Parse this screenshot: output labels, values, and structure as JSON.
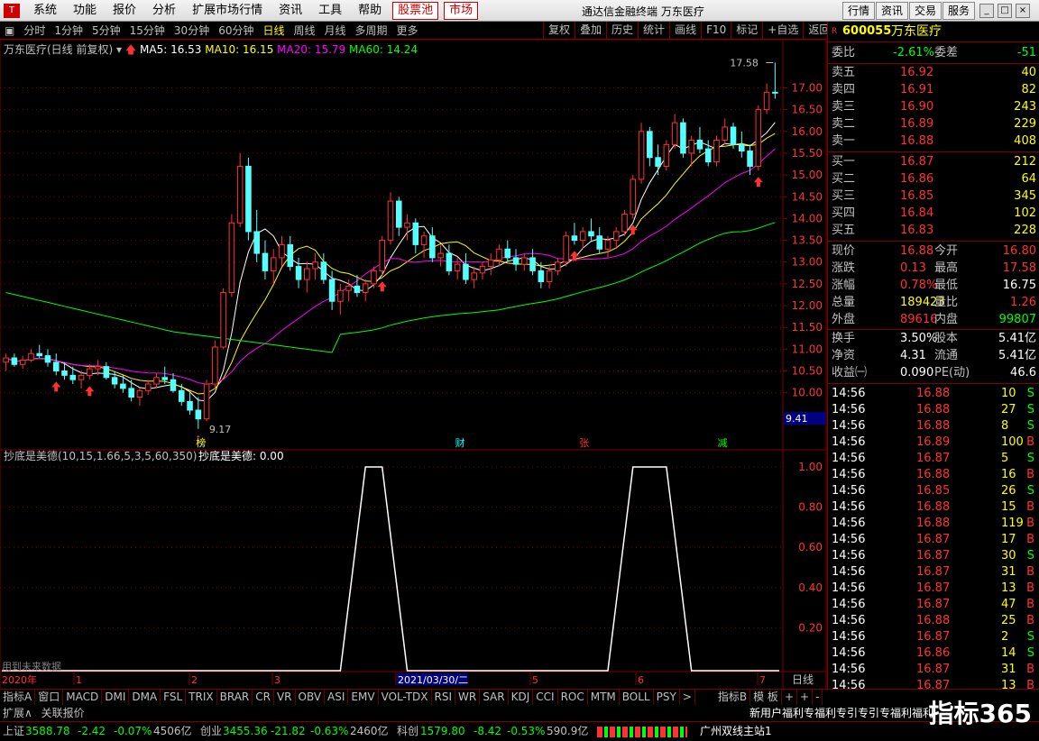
{
  "menu": {
    "logo": "T",
    "items": [
      "系统",
      "功能",
      "报价",
      "分析",
      "扩展市场行情",
      "资讯",
      "工具",
      "帮助"
    ],
    "hot": [
      "股票池",
      "市场"
    ],
    "title": "通达信金融终端  万东医疗",
    "right": [
      "行情",
      "资讯",
      "交易",
      "服务"
    ]
  },
  "period": {
    "items": [
      "分时",
      "1分钟",
      "5分钟",
      "15分钟",
      "30分钟",
      "60分钟",
      "日线",
      "周线",
      "月线",
      "多周期",
      "更多"
    ],
    "active_index": 6,
    "tools": [
      "复权",
      "叠加",
      "历史",
      "统计",
      "画线",
      "F10",
      "标记",
      "+自选",
      "返回"
    ]
  },
  "chart_info": {
    "name": "万东医疗(日线 前复权)",
    "ma5": "MA5: 16.53",
    "ma10": "MA10: 16.15",
    "ma20": "MA20: 15.79",
    "ma60": "MA60: 14.24"
  },
  "colors": {
    "up": "#ff3232",
    "down": "#54ffff",
    "ma5": "#ffffff",
    "ma10": "#ffff00",
    "ma20": "#ff00ff",
    "ma60": "#00ff00",
    "border": "#800000"
  },
  "chart_data": {
    "type": "candlestick",
    "price_axis": [
      "17.00",
      "16.50",
      "16.00",
      "15.50",
      "15.00",
      "14.50",
      "14.00",
      "13.50",
      "13.00",
      "12.50",
      "12.00",
      "11.50",
      "11.00",
      "10.50",
      "10.00"
    ],
    "ylim": [
      9.0,
      17.9
    ],
    "high_label": "17.58",
    "low_label": "9.17",
    "crosshair_value": "9.41",
    "date_axis": [
      "2020年",
      "1",
      "2",
      "3",
      "2021/03/30/二",
      "5",
      "6",
      "7"
    ],
    "period_label": "日线",
    "events": [
      "榜",
      "财",
      "张",
      "减"
    ],
    "candles": [
      [
        10.7,
        10.9,
        10.5,
        10.8
      ],
      [
        10.8,
        10.9,
        10.6,
        10.65
      ],
      [
        10.65,
        10.85,
        10.55,
        10.75
      ],
      [
        10.75,
        11.0,
        10.7,
        10.9
      ],
      [
        10.9,
        11.1,
        10.8,
        10.85
      ],
      [
        10.85,
        11.0,
        10.6,
        10.7
      ],
      [
        10.7,
        10.9,
        10.4,
        10.5
      ],
      [
        10.5,
        10.7,
        10.3,
        10.4
      ],
      [
        10.4,
        10.6,
        10.2,
        10.3
      ],
      [
        10.3,
        10.5,
        10.1,
        10.4
      ],
      [
        10.4,
        10.65,
        10.3,
        10.55
      ],
      [
        10.55,
        10.75,
        10.4,
        10.6
      ],
      [
        10.6,
        10.7,
        10.3,
        10.35
      ],
      [
        10.35,
        10.5,
        10.1,
        10.2
      ],
      [
        10.2,
        10.4,
        10.0,
        10.1
      ],
      [
        10.1,
        10.3,
        9.8,
        9.9
      ],
      [
        9.9,
        10.1,
        9.7,
        10.05
      ],
      [
        10.05,
        10.3,
        9.95,
        10.2
      ],
      [
        10.2,
        10.45,
        10.1,
        10.35
      ],
      [
        10.35,
        10.6,
        10.2,
        10.3
      ],
      [
        10.3,
        10.45,
        10.0,
        10.05
      ],
      [
        10.05,
        10.2,
        9.7,
        9.8
      ],
      [
        9.8,
        10.0,
        9.5,
        9.6
      ],
      [
        9.6,
        9.9,
        9.17,
        9.4
      ],
      [
        9.4,
        10.3,
        9.35,
        10.2
      ],
      [
        10.2,
        11.2,
        10.1,
        11.05
      ],
      [
        11.05,
        12.4,
        11.0,
        12.3
      ],
      [
        12.3,
        14.1,
        12.2,
        13.9
      ],
      [
        13.9,
        15.5,
        13.8,
        15.2
      ],
      [
        15.2,
        15.4,
        13.5,
        13.7
      ],
      [
        13.7,
        14.2,
        13.0,
        13.2
      ],
      [
        13.2,
        13.5,
        12.6,
        12.8
      ],
      [
        12.8,
        13.3,
        12.5,
        13.1
      ],
      [
        13.1,
        13.6,
        12.9,
        13.4
      ],
      [
        13.4,
        13.6,
        12.8,
        12.9
      ],
      [
        12.9,
        13.1,
        12.4,
        12.6
      ],
      [
        12.6,
        13.0,
        12.3,
        12.85
      ],
      [
        12.85,
        13.2,
        12.6,
        13.0
      ],
      [
        13.0,
        13.2,
        12.5,
        12.6
      ],
      [
        12.6,
        12.8,
        11.9,
        12.1
      ],
      [
        12.1,
        12.5,
        11.8,
        12.35
      ],
      [
        12.35,
        12.6,
        12.1,
        12.45
      ],
      [
        12.45,
        12.7,
        12.2,
        12.3
      ],
      [
        12.3,
        12.6,
        12.1,
        12.5
      ],
      [
        12.5,
        12.9,
        12.4,
        12.8
      ],
      [
        12.8,
        13.6,
        12.7,
        13.5
      ],
      [
        13.5,
        14.6,
        13.4,
        14.4
      ],
      [
        14.4,
        14.5,
        13.6,
        13.8
      ],
      [
        13.8,
        14.1,
        13.5,
        13.9
      ],
      [
        13.9,
        14.0,
        13.2,
        13.4
      ],
      [
        13.4,
        13.7,
        13.1,
        13.6
      ],
      [
        13.6,
        13.8,
        13.0,
        13.1
      ],
      [
        13.1,
        13.4,
        12.9,
        13.2
      ],
      [
        13.2,
        13.4,
        12.7,
        12.8
      ],
      [
        12.8,
        13.1,
        12.6,
        12.95
      ],
      [
        12.95,
        13.2,
        12.5,
        12.6
      ],
      [
        12.6,
        12.9,
        12.4,
        12.75
      ],
      [
        12.75,
        13.0,
        12.6,
        12.9
      ],
      [
        12.9,
        13.2,
        12.7,
        13.05
      ],
      [
        13.05,
        13.4,
        12.9,
        13.3
      ],
      [
        13.3,
        13.5,
        13.0,
        13.1
      ],
      [
        13.1,
        13.3,
        12.8,
        12.95
      ],
      [
        12.95,
        13.2,
        12.8,
        13.1
      ],
      [
        13.1,
        13.3,
        12.7,
        12.8
      ],
      [
        12.8,
        13.0,
        12.4,
        12.55
      ],
      [
        12.55,
        12.9,
        12.4,
        12.8
      ],
      [
        12.8,
        13.1,
        12.7,
        13.0
      ],
      [
        13.0,
        13.7,
        12.9,
        13.6
      ],
      [
        13.6,
        13.9,
        13.4,
        13.5
      ],
      [
        13.5,
        13.8,
        13.3,
        13.7
      ],
      [
        13.7,
        14.0,
        13.5,
        13.6
      ],
      [
        13.6,
        13.8,
        13.2,
        13.3
      ],
      [
        13.3,
        13.6,
        13.1,
        13.5
      ],
      [
        13.5,
        13.8,
        13.3,
        13.7
      ],
      [
        13.7,
        14.2,
        13.6,
        14.1
      ],
      [
        14.1,
        15.0,
        14.0,
        14.9
      ],
      [
        14.9,
        16.2,
        14.8,
        16.0
      ],
      [
        16.0,
        16.1,
        15.2,
        15.4
      ],
      [
        15.4,
        15.7,
        15.0,
        15.2
      ],
      [
        15.2,
        15.8,
        15.1,
        15.7
      ],
      [
        15.7,
        16.4,
        15.6,
        16.2
      ],
      [
        16.2,
        16.3,
        15.4,
        15.5
      ],
      [
        15.5,
        15.9,
        15.2,
        15.8
      ],
      [
        15.8,
        16.1,
        15.5,
        15.6
      ],
      [
        15.6,
        15.8,
        15.2,
        15.3
      ],
      [
        15.3,
        15.9,
        15.2,
        15.8
      ],
      [
        15.8,
        16.3,
        15.7,
        16.1
      ],
      [
        16.1,
        16.2,
        15.6,
        15.7
      ],
      [
        15.7,
        16.0,
        15.4,
        15.55
      ],
      [
        15.55,
        15.7,
        15.0,
        15.2
      ],
      [
        15.2,
        16.6,
        15.1,
        16.5
      ],
      [
        16.5,
        17.1,
        16.4,
        16.9
      ],
      [
        16.9,
        17.58,
        16.75,
        16.88
      ]
    ]
  },
  "indicator": {
    "title": "抄底是美德(10,15,1.66,5,3,5,60,350)",
    "value": "抄底是美德: 0.00",
    "axis": [
      "1.00",
      "0.80",
      "0.60",
      "0.40",
      "0.20"
    ],
    "footnote": "用到未来数据",
    "pulses": [
      [
        43,
        45
      ],
      [
        75,
        79
      ]
    ],
    "pulse_level": 1.0
  },
  "quote": {
    "code_marker": "R",
    "code": "600055",
    "name": "万东医疗",
    "weibi_label": "委比",
    "weibi_value": "-2.61%",
    "weicha_label": "委差",
    "weicha_value": "-51",
    "asks": [
      {
        "label": "卖五",
        "price": "16.92",
        "vol": "40"
      },
      {
        "label": "卖四",
        "price": "16.91",
        "vol": "82"
      },
      {
        "label": "卖三",
        "price": "16.90",
        "vol": "243"
      },
      {
        "label": "卖二",
        "price": "16.89",
        "vol": "229"
      },
      {
        "label": "卖一",
        "price": "16.88",
        "vol": "408"
      }
    ],
    "bids": [
      {
        "label": "买一",
        "price": "16.87",
        "vol": "212"
      },
      {
        "label": "买二",
        "price": "16.86",
        "vol": "64"
      },
      {
        "label": "买三",
        "price": "16.85",
        "vol": "345"
      },
      {
        "label": "买四",
        "price": "16.84",
        "vol": "102"
      },
      {
        "label": "买五",
        "price": "16.83",
        "vol": "228"
      }
    ],
    "stats": [
      {
        "l1": "现价",
        "v1": "16.88",
        "c1": "#ff3232",
        "l2": "今开",
        "v2": "16.80",
        "c2": "#ff3232"
      },
      {
        "l1": "涨跌",
        "v1": "0.13",
        "c1": "#ff3232",
        "l2": "最高",
        "v2": "17.58",
        "c2": "#ff3232"
      },
      {
        "l1": "涨幅",
        "v1": "0.78%",
        "c1": "#ff3232",
        "l2": "最低",
        "v2": "16.75",
        "c2": "#ffffff"
      },
      {
        "l1": "总量",
        "v1": "189423",
        "c1": "#ffff00",
        "l2": "量比",
        "v2": "1.26",
        "c2": "#ff3232"
      },
      {
        "l1": "外盘",
        "v1": "89616",
        "c1": "#ff3232",
        "l2": "内盘",
        "v2": "99807",
        "c2": "#00ff00"
      },
      {
        "l1": "换手",
        "v1": "3.50%",
        "c1": "#ffffff",
        "l2": "股本",
        "v2": "5.41亿",
        "c2": "#ffffff"
      },
      {
        "l1": "净资",
        "v1": "4.31",
        "c1": "#ffffff",
        "l2": "流通",
        "v2": "5.41亿",
        "c2": "#ffffff"
      },
      {
        "l1": "收益㈠",
        "v1": "0.090",
        "c1": "#ffffff",
        "l2": "PE(动)",
        "v2": "46.6",
        "c2": "#ffffff"
      }
    ],
    "ticks": [
      {
        "t": "14:56",
        "p": "16.88",
        "v": "10",
        "s": "S"
      },
      {
        "t": "14:56",
        "p": "16.88",
        "v": "27",
        "s": "S"
      },
      {
        "t": "14:56",
        "p": "16.88",
        "v": "8",
        "s": "S"
      },
      {
        "t": "14:56",
        "p": "16.89",
        "v": "100",
        "s": "B"
      },
      {
        "t": "14:56",
        "p": "16.87",
        "v": "5",
        "s": "S"
      },
      {
        "t": "14:56",
        "p": "16.88",
        "v": "16",
        "s": "B"
      },
      {
        "t": "14:56",
        "p": "16.85",
        "v": "26",
        "s": "S"
      },
      {
        "t": "14:56",
        "p": "16.88",
        "v": "15",
        "s": "B"
      },
      {
        "t": "14:56",
        "p": "16.88",
        "v": "119",
        "s": "B"
      },
      {
        "t": "14:56",
        "p": "16.87",
        "v": "17",
        "s": "B"
      },
      {
        "t": "14:56",
        "p": "16.87",
        "v": "30",
        "s": "S"
      },
      {
        "t": "14:56",
        "p": "16.87",
        "v": "31",
        "s": "B"
      },
      {
        "t": "14:56",
        "p": "16.87",
        "v": "13",
        "s": "B"
      },
      {
        "t": "14:56",
        "p": "16.87",
        "v": "47",
        "s": "B"
      },
      {
        "t": "14:56",
        "p": "16.88",
        "v": "25",
        "s": "B"
      },
      {
        "t": "14:56",
        "p": "16.87",
        "v": "2",
        "s": "S"
      },
      {
        "t": "14:56",
        "p": "16.86",
        "v": "14",
        "s": "S"
      },
      {
        "t": "14:56",
        "p": "16.87",
        "v": "31",
        "s": "B"
      },
      {
        "t": "14:56",
        "p": "16.87",
        "v": "13",
        "s": "B"
      }
    ]
  },
  "bottom_tabs": [
    "指标A",
    "窗口",
    "MACD",
    "DMI",
    "DMA",
    "FSL",
    "TRIX",
    "BRAR",
    "CR",
    "VR",
    "OBV",
    "ASI",
    "EMV",
    "VOL-TDX",
    "RSI",
    "WR",
    "SAR",
    "KDJ",
    "CCI",
    "ROC",
    "MTM",
    "BOLL",
    "PSY",
    ">",
    "指标B",
    "模 板",
    "+",
    "+",
    "-"
  ],
  "expand": [
    "扩展∧",
    "关联报价"
  ],
  "status": {
    "sh_label": "上证",
    "sh_val": "3588.78",
    "sh_chg": "-2.42",
    "sh_pct": "-0.07%",
    "sh_amt": "4506亿",
    "cy_label": "创业",
    "cy_val": "3455.36",
    "cy_chg": "-21.82",
    "cy_pct": "-0.63%",
    "cy_amt": "2460亿",
    "kc_label": "科创",
    "kc_val": "1579.80",
    "kc_chg": "-8.42",
    "kc_pct": "-0.53%",
    "kc_amt": "590.9亿",
    "server": "广州双线主站1",
    "news": "新用户福利专福利专引专引专福利福利"
  },
  "watermark": "指标365"
}
